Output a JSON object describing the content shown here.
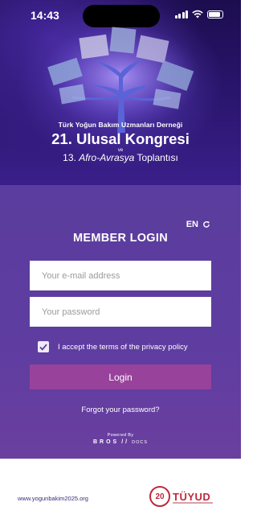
{
  "status_bar": {
    "time": "14:43"
  },
  "hero": {
    "organization": "Türk Yoğun Bakım Uzmanları Derneği",
    "congress": "21. Ulusal Kongresi",
    "conjunction": "ve",
    "meeting_number": "13.",
    "meeting_name": "Afro-Avrasya",
    "meeting_suffix": "Toplantısı"
  },
  "login": {
    "language": "EN",
    "title": "MEMBER LOGIN",
    "email_placeholder": "Your e-mail address",
    "password_placeholder": "Your password",
    "terms_label": "I accept the terms of the privacy policy",
    "terms_checked": true,
    "login_button": "Login",
    "forgot_password": "Forgot your password?",
    "powered_by": "Powered By",
    "powered_brand": "BROS",
    "powered_brand_suffix": "DOCS"
  },
  "footer": {
    "website": "www.yogunbakim2025.org",
    "logo_number": "20",
    "logo_text": "TÜYUD"
  },
  "colors": {
    "panel": "#5f3da0",
    "button": "#98429b",
    "brand_red": "#c0283c",
    "website_text": "#3b2a7a"
  }
}
